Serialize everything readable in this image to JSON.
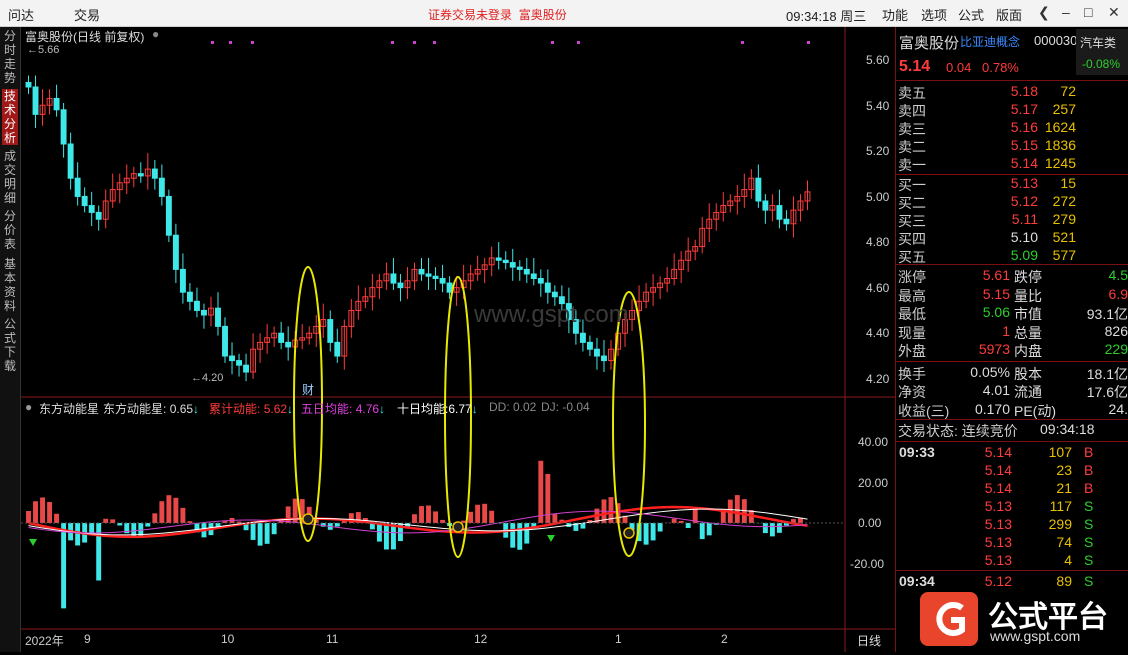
{
  "topbar": {
    "menu": [
      "问达",
      "交易"
    ],
    "notice": "证券交易未登录",
    "stock_link": "富奥股份",
    "clock": "09:34:18 周三",
    "right_menu": [
      "功能",
      "选项",
      "公式",
      "版面"
    ]
  },
  "sidebar": {
    "tabs": [
      "分时走势",
      "技术分析",
      "成交明细",
      "分价表",
      "基本资料",
      "公式下载"
    ],
    "active": 1
  },
  "chart": {
    "title": "富奥股份(日线 前复权)",
    "high_label": "5.66",
    "low_label": "4.20",
    "price_axis": [
      "5.60",
      "5.40",
      "5.20",
      "5.00",
      "4.80",
      "4.60",
      "4.40",
      "4.20"
    ],
    "ind_axis": [
      "40.00",
      "20.00",
      "0.00",
      "-20.00"
    ],
    "watermark": "www.gspt.com",
    "cai_label": "财",
    "indicator": {
      "name": "东方动能星",
      "line1_label": "东方动能星:",
      "line1_value": "0.65",
      "line2_label": "累计动能:",
      "line2_value": "5.62",
      "line3_label": "五日均能:",
      "line3_value": "4.76",
      "line4_label": "十日均能:",
      "line4_value": "6.77",
      "dd": "DD: 0.02",
      "dj": "DJ: -0.04"
    },
    "date_axis": [
      "2022年",
      "9",
      "10",
      "11",
      "12",
      "1",
      "2"
    ],
    "period": "日线",
    "colors": {
      "up": "#ff3c3c",
      "down": "#3ee8e8",
      "accent": "#e8e800"
    }
  },
  "quote": {
    "name": "富奥股份",
    "code": "000030",
    "concept": "比亚迪概念",
    "sector": "汽车类",
    "sector_change": "-0.08%",
    "price": "5.14",
    "change": "0.04",
    "change_pct": "0.78%",
    "asks": [
      {
        "label": "卖五",
        "price": "5.18",
        "vol": "72"
      },
      {
        "label": "卖四",
        "price": "5.17",
        "vol": "257"
      },
      {
        "label": "卖三",
        "price": "5.16",
        "vol": "1624"
      },
      {
        "label": "卖二",
        "price": "5.15",
        "vol": "1836"
      },
      {
        "label": "卖一",
        "price": "5.14",
        "vol": "1245"
      }
    ],
    "bids": [
      {
        "label": "买一",
        "price": "5.13",
        "vol": "15"
      },
      {
        "label": "买二",
        "price": "5.12",
        "vol": "272"
      },
      {
        "label": "买三",
        "price": "5.11",
        "vol": "279"
      },
      {
        "label": "买四",
        "price": "5.10",
        "vol": "521"
      },
      {
        "label": "买五",
        "price": "5.09",
        "vol": "577"
      }
    ],
    "stats": [
      {
        "l1": "涨停",
        "v1": "5.61",
        "l2": "跌停",
        "v2": "4.5"
      },
      {
        "l1": "最高",
        "v1": "5.15",
        "l2": "量比",
        "v2": "6.9"
      },
      {
        "l1": "最低",
        "v1": "5.06",
        "l2": "市值",
        "v2": "93.1亿"
      },
      {
        "l1": "现量",
        "v1": "1",
        "l2": "总量",
        "v2": "826"
      },
      {
        "l1": "外盘",
        "v1": "5973",
        "l2": "内盘",
        "v2": "229"
      }
    ],
    "stats2": [
      {
        "l1": "换手",
        "v1": "0.05%",
        "l2": "股本",
        "v2": "18.1亿"
      },
      {
        "l1": "净资",
        "v1": "4.01",
        "l2": "流通",
        "v2": "17.6亿"
      },
      {
        "l1": "收益(三)",
        "v1": "0.170",
        "l2": "PE(动)",
        "v2": "24."
      }
    ],
    "trade_status": "交易状态: 连续竞价",
    "trade_time": "09:34:18",
    "ticks": [
      {
        "t": "09:33",
        "p": "5.14",
        "v": "107",
        "s": "B"
      },
      {
        "t": "",
        "p": "5.14",
        "v": "23",
        "s": "B"
      },
      {
        "t": "",
        "p": "5.14",
        "v": "21",
        "s": "B"
      },
      {
        "t": "",
        "p": "5.13",
        "v": "117",
        "s": "S"
      },
      {
        "t": "",
        "p": "5.13",
        "v": "299",
        "s": "S"
      },
      {
        "t": "",
        "p": "5.13",
        "v": "74",
        "s": "S"
      },
      {
        "t": "",
        "p": "5.13",
        "v": "4",
        "s": "S"
      },
      {
        "t": "09:34",
        "p": "5.12",
        "v": "89",
        "s": "S"
      }
    ],
    "logo_title": "公式平台",
    "logo_url": "www.gspt.com"
  }
}
